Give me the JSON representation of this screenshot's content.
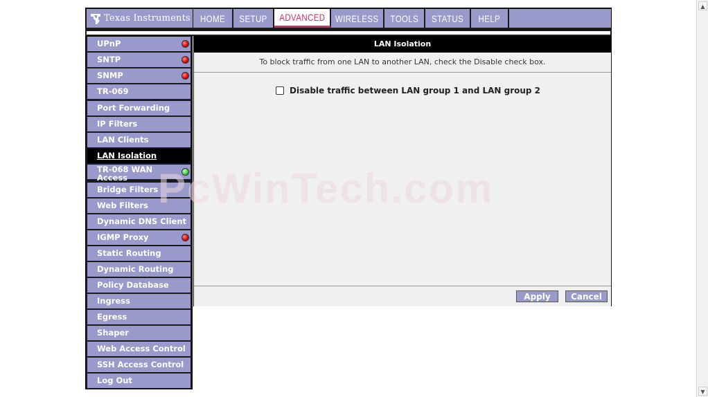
{
  "brand": {
    "name": "Texas Instruments"
  },
  "nav": {
    "tabs": [
      {
        "label": "HOME",
        "active": false
      },
      {
        "label": "SETUP",
        "active": false
      },
      {
        "label": "ADVANCED",
        "active": true
      },
      {
        "label": "WIRELESS",
        "active": false
      },
      {
        "label": "TOOLS",
        "active": false
      },
      {
        "label": "STATUS",
        "active": false
      },
      {
        "label": "HELP",
        "active": false
      }
    ]
  },
  "sidebar": {
    "items": [
      {
        "label": "UPnP",
        "status": "red"
      },
      {
        "label": "SNTP",
        "status": "red"
      },
      {
        "label": "SNMP",
        "status": "red"
      },
      {
        "label": "TR-069",
        "status": ""
      },
      {
        "label": "Port Forwarding",
        "status": ""
      },
      {
        "label": "IP Filters",
        "status": ""
      },
      {
        "label": "LAN Clients",
        "status": ""
      },
      {
        "label": "LAN Isolation",
        "status": "",
        "active": true
      },
      {
        "label": "TR-068 WAN Access",
        "status": "green"
      },
      {
        "label": "Bridge Filters",
        "status": ""
      },
      {
        "label": "Web Filters",
        "status": ""
      },
      {
        "label": "Dynamic DNS Client",
        "status": ""
      },
      {
        "label": "IGMP Proxy",
        "status": "red"
      },
      {
        "label": "Static Routing",
        "status": ""
      },
      {
        "label": "Dynamic Routing",
        "status": ""
      },
      {
        "label": "Policy Database",
        "status": ""
      },
      {
        "label": "Ingress",
        "status": ""
      },
      {
        "label": "Egress",
        "status": ""
      },
      {
        "label": "Shaper",
        "status": ""
      },
      {
        "label": "Web Access Control",
        "status": ""
      },
      {
        "label": "SSH Access Control",
        "status": ""
      },
      {
        "label": "Log Out",
        "status": ""
      }
    ]
  },
  "content": {
    "title": "LAN Isolation",
    "instruction": "To block traffic from one LAN to another LAN, check the Disable check box.",
    "option_label": "Disable traffic between LAN group 1 and LAN group 2",
    "option_checked": false,
    "apply_label": "Apply",
    "cancel_label": "Cancel"
  },
  "watermark": "PcWinTech.com",
  "colors": {
    "accent": "#9999cc",
    "active_tab_text": "#cc3366",
    "status_red": "#dd0000",
    "status_green": "#33cc33"
  }
}
